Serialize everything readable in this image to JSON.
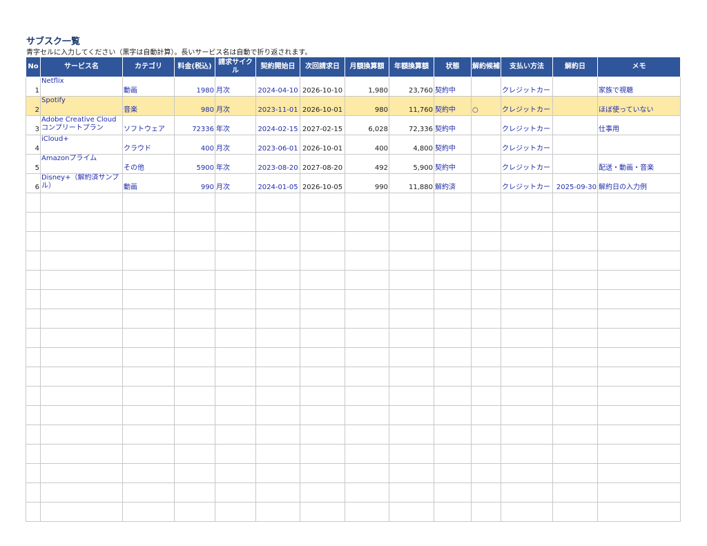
{
  "title": "サブスク一覧",
  "subtitle": "青字セルに入力してください（黒字は自動計算）。長いサービス名は自動で折り返されます。",
  "columns": [
    "No",
    "サービス名",
    "カテゴリ",
    "料金(税込)",
    "請求サイクル",
    "契約開始日",
    "次回請求日",
    "月額換算額",
    "年額換算額",
    "状態",
    "解約候補",
    "支払い方法",
    "解約日",
    "メモ"
  ],
  "rows": [
    {
      "no": "1",
      "name": "Netflix",
      "category": "動画",
      "price": "1980",
      "cycle": "月次",
      "start": "2024-04-10",
      "next": "2026-10-10",
      "monthly": "1,980",
      "yearly": "23,760",
      "status": "契約中",
      "candidate": "",
      "payment": "クレジットカードA",
      "cancel": "",
      "memo": "家族で視聴"
    },
    {
      "no": "2",
      "name": "Spotify",
      "category": "音楽",
      "price": "980",
      "cycle": "月次",
      "start": "2023-11-01",
      "next": "2026-10-01",
      "monthly": "980",
      "yearly": "11,760",
      "status": "契約中",
      "candidate": "○",
      "payment": "クレジットカードA",
      "cancel": "",
      "memo": "ほぼ使っていない"
    },
    {
      "no": "3",
      "name": "Adobe Creative Cloud コンプリートプラン",
      "category": "ソフトウェア",
      "price": "72336",
      "cycle": "年次",
      "start": "2024-02-15",
      "next": "2027-02-15",
      "monthly": "6,028",
      "yearly": "72,336",
      "status": "契約中",
      "candidate": "",
      "payment": "クレジットカードB",
      "cancel": "",
      "memo": "仕事用"
    },
    {
      "no": "4",
      "name": "iCloud+",
      "category": "クラウド",
      "price": "400",
      "cycle": "月次",
      "start": "2023-06-01",
      "next": "2026-10-01",
      "monthly": "400",
      "yearly": "4,800",
      "status": "契約中",
      "candidate": "",
      "payment": "クレジットカードA",
      "cancel": "",
      "memo": ""
    },
    {
      "no": "5",
      "name": "Amazonプライム",
      "category": "その他",
      "price": "5900",
      "cycle": "年次",
      "start": "2023-08-20",
      "next": "2027-08-20",
      "monthly": "492",
      "yearly": "5,900",
      "status": "契約中",
      "candidate": "",
      "payment": "クレジットカードB",
      "cancel": "",
      "memo": "配送・動画・音楽"
    },
    {
      "no": "6",
      "name": "Disney+（解約済サンプル）",
      "category": "動画",
      "price": "990",
      "cycle": "月次",
      "start": "2024-01-05",
      "next": "2026-10-05",
      "monthly": "990",
      "yearly": "11,880",
      "status": "解約済",
      "candidate": "",
      "payment": "クレジットカード",
      "cancel": "2025-09-30",
      "memo": "解約日の入力例"
    }
  ],
  "highlight_row_index": 1,
  "empty_row_count": 17,
  "colors": {
    "header_bg": "#2f559a",
    "highlight_bg": "#fdeaa6",
    "input_text": "#1f2ba8",
    "title": "#1f3a6e"
  }
}
